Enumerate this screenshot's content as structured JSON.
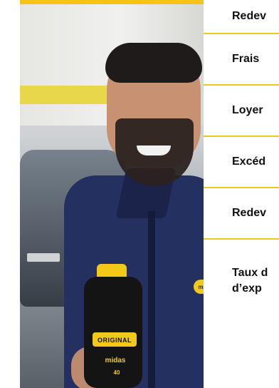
{
  "colors": {
    "accent": "#f2c51b",
    "text": "#111111"
  },
  "photo": {
    "brand_badge": "midas",
    "bottle_brand": "midas",
    "bottle_line": "ORIGINAL",
    "bottle_small": "40"
  },
  "list": {
    "items": [
      {
        "label": "Redev"
      },
      {
        "label": "Frais"
      },
      {
        "label": "Loyer"
      },
      {
        "label": "Excéd"
      },
      {
        "label": "Redev"
      },
      {
        "label_line1": "Taux d",
        "label_line2": "d’exp"
      }
    ]
  }
}
